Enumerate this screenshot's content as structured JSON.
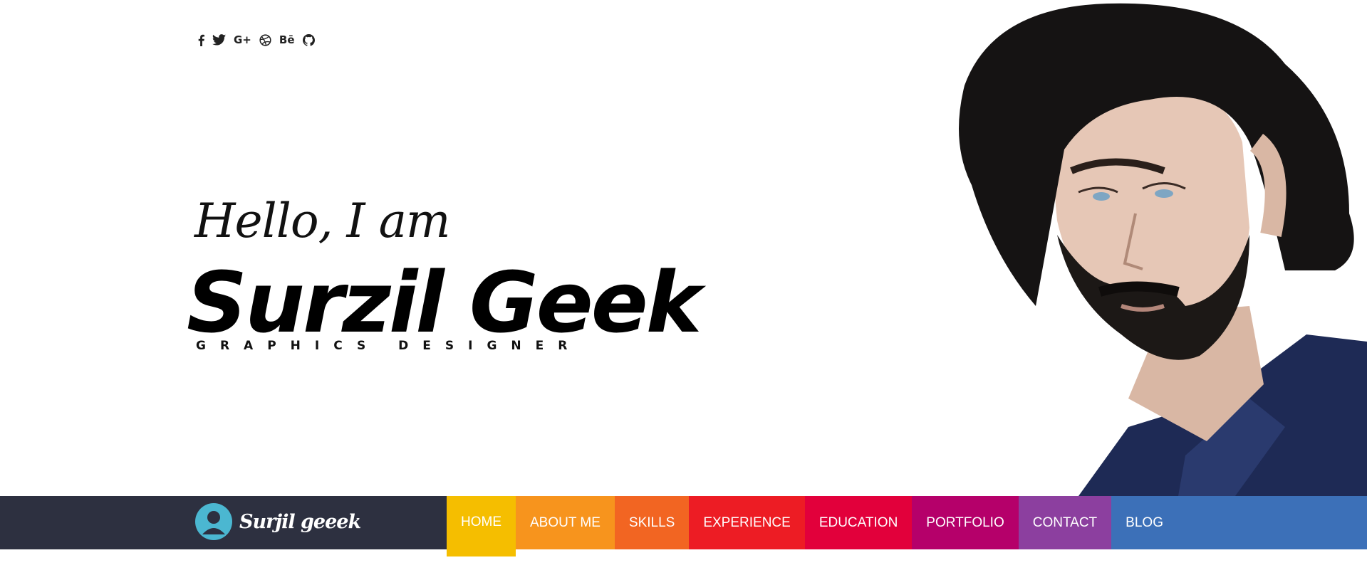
{
  "social": {
    "items": [
      {
        "name": "facebook-icon",
        "label": ""
      },
      {
        "name": "twitter-icon",
        "label": ""
      },
      {
        "name": "google-plus-icon",
        "label": "G+"
      },
      {
        "name": "dribbble-icon",
        "label": ""
      },
      {
        "name": "behance-icon",
        "label": "Bē"
      },
      {
        "name": "github-icon",
        "label": ""
      }
    ]
  },
  "hero": {
    "greeting": "Hello, I am",
    "name": "Surzil Geek",
    "role": "GRAPHICS DESIGNER"
  },
  "brand": {
    "name": "Surjil geeek",
    "avatar_color": "#4bb7d1"
  },
  "nav": {
    "background": "#3c70b8",
    "brand_background": "#2d3040",
    "items": [
      {
        "label": "HOME",
        "color": "#f5be00",
        "active": true
      },
      {
        "label": "ABOUT ME",
        "color": "#f7941d"
      },
      {
        "label": "SKILLS",
        "color": "#f26522"
      },
      {
        "label": "EXPERIENCE",
        "color": "#ed1c24"
      },
      {
        "label": "EDUCATION",
        "color": "#e2003b"
      },
      {
        "label": "PORTFOLIO",
        "color": "#b5006a"
      },
      {
        "label": "CONTACT",
        "color": "#8c3f9f"
      },
      {
        "label": "BLOG",
        "color": "#3c70b8"
      }
    ]
  }
}
